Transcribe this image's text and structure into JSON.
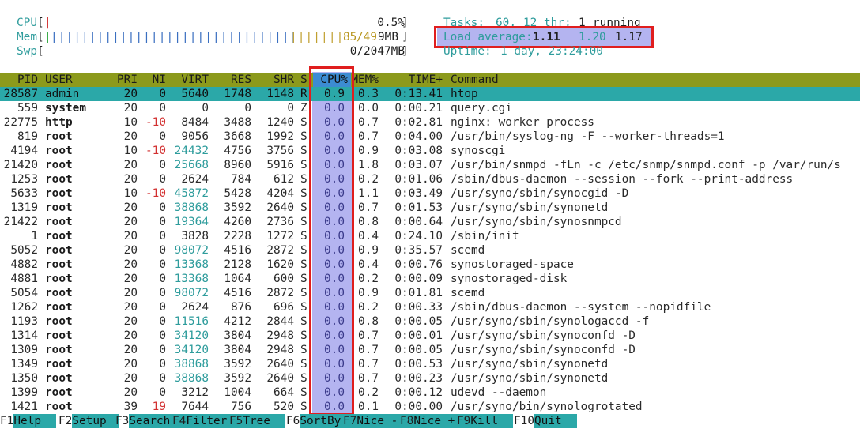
{
  "meters": {
    "cpu": {
      "label": "CPU",
      "bar": "|",
      "value": "0.5%"
    },
    "mem": {
      "label": "Mem",
      "bar_blue": "||||||||||||||||||||||||||||||||",
      "bar_yellow": "|||||||",
      "value_used": "85",
      "value_sep": "/49",
      "value_rest": "9MB"
    },
    "swp": {
      "label": "Swp",
      "value": "0/2047MB"
    }
  },
  "tasks": {
    "label": "Tasks:",
    "tasks": "60,",
    "thr_count": "12",
    "thr_label": "thr;",
    "running_count": "1",
    "running_label": "running"
  },
  "load": {
    "label": "Load average:",
    "l1": "1.11",
    "l5": "1.20",
    "l15": "1.17"
  },
  "uptime": {
    "label": "Uptime:",
    "value": "1 day, 23:24:00"
  },
  "columns": [
    "PID",
    "USER",
    "PRI",
    "NI",
    "VIRT",
    "RES",
    "SHR",
    "S",
    "CPU%",
    "MEM%",
    "TIME+",
    "Command"
  ],
  "processes": [
    {
      "pid": "28587",
      "user": "admin",
      "pri": "20",
      "ni": "0",
      "virt": "5640",
      "res": "1748",
      "shr": "1148",
      "s": "R",
      "cpu": "0.9",
      "mem": "0.3",
      "time": "0:13.41",
      "cmd": "htop"
    },
    {
      "pid": "559",
      "user": "system",
      "pri": "20",
      "ni": "0",
      "virt": "0",
      "res": "0",
      "shr": "0",
      "s": "Z",
      "cpu": "0.0",
      "mem": "0.0",
      "time": "0:00.21",
      "cmd": "query.cgi"
    },
    {
      "pid": "22775",
      "user": "http",
      "pri": "10",
      "ni": "-10",
      "virt": "8484",
      "res": "3488",
      "shr": "1240",
      "s": "S",
      "cpu": "0.0",
      "mem": "0.7",
      "time": "0:02.81",
      "cmd": "nginx: worker process"
    },
    {
      "pid": "819",
      "user": "root",
      "pri": "20",
      "ni": "0",
      "virt": "9056",
      "res": "3668",
      "shr": "1992",
      "s": "S",
      "cpu": "0.0",
      "mem": "0.7",
      "time": "0:04.00",
      "cmd": "/usr/bin/syslog-ng -F --worker-threads=1"
    },
    {
      "pid": "4194",
      "user": "root",
      "pri": "10",
      "ni": "-10",
      "virt": "24432",
      "res": "4756",
      "shr": "3756",
      "s": "S",
      "cpu": "0.0",
      "mem": "0.9",
      "time": "0:03.08",
      "cmd": "synoscgi"
    },
    {
      "pid": "21420",
      "user": "root",
      "pri": "20",
      "ni": "0",
      "virt": "25668",
      "res": "8960",
      "shr": "5916",
      "s": "S",
      "cpu": "0.0",
      "mem": "1.8",
      "time": "0:03.07",
      "cmd": "/usr/bin/snmpd -fLn -c /etc/snmp/snmpd.conf -p /var/run/s"
    },
    {
      "pid": "1253",
      "user": "root",
      "pri": "20",
      "ni": "0",
      "virt": "2624",
      "res": "784",
      "shr": "612",
      "s": "S",
      "cpu": "0.0",
      "mem": "0.2",
      "time": "0:01.06",
      "cmd": "/sbin/dbus-daemon --session --fork --print-address"
    },
    {
      "pid": "5633",
      "user": "root",
      "pri": "10",
      "ni": "-10",
      "virt": "45872",
      "res": "5428",
      "shr": "4204",
      "s": "S",
      "cpu": "0.0",
      "mem": "1.1",
      "time": "0:03.49",
      "cmd": "/usr/syno/sbin/synocgid -D"
    },
    {
      "pid": "1319",
      "user": "root",
      "pri": "20",
      "ni": "0",
      "virt": "38868",
      "res": "3592",
      "shr": "2640",
      "s": "S",
      "cpu": "0.0",
      "mem": "0.7",
      "time": "0:01.53",
      "cmd": "/usr/syno/sbin/synonetd"
    },
    {
      "pid": "21422",
      "user": "root",
      "pri": "20",
      "ni": "0",
      "virt": "19364",
      "res": "4260",
      "shr": "2736",
      "s": "S",
      "cpu": "0.0",
      "mem": "0.8",
      "time": "0:00.64",
      "cmd": "/usr/syno/sbin/synosnmpcd"
    },
    {
      "pid": "1",
      "user": "root",
      "pri": "20",
      "ni": "0",
      "virt": "3828",
      "res": "2228",
      "shr": "1272",
      "s": "S",
      "cpu": "0.0",
      "mem": "0.4",
      "time": "0:24.10",
      "cmd": "/sbin/init"
    },
    {
      "pid": "5052",
      "user": "root",
      "pri": "20",
      "ni": "0",
      "virt": "98072",
      "res": "4516",
      "shr": "2872",
      "s": "S",
      "cpu": "0.0",
      "mem": "0.9",
      "time": "0:35.57",
      "cmd": "scemd"
    },
    {
      "pid": "4882",
      "user": "root",
      "pri": "20",
      "ni": "0",
      "virt": "13368",
      "res": "2128",
      "shr": "1620",
      "s": "S",
      "cpu": "0.0",
      "mem": "0.4",
      "time": "0:00.76",
      "cmd": "synostoraged-space"
    },
    {
      "pid": "4881",
      "user": "root",
      "pri": "20",
      "ni": "0",
      "virt": "13368",
      "res": "1064",
      "shr": "600",
      "s": "S",
      "cpu": "0.0",
      "mem": "0.2",
      "time": "0:00.09",
      "cmd": "synostoraged-disk"
    },
    {
      "pid": "5054",
      "user": "root",
      "pri": "20",
      "ni": "0",
      "virt": "98072",
      "res": "4516",
      "shr": "2872",
      "s": "S",
      "cpu": "0.0",
      "mem": "0.9",
      "time": "0:01.81",
      "cmd": "scemd"
    },
    {
      "pid": "1262",
      "user": "root",
      "pri": "20",
      "ni": "0",
      "virt": "2624",
      "res": "876",
      "shr": "696",
      "s": "S",
      "cpu": "0.0",
      "mem": "0.2",
      "time": "0:00.33",
      "cmd": "/sbin/dbus-daemon --system --nopidfile"
    },
    {
      "pid": "1193",
      "user": "root",
      "pri": "20",
      "ni": "0",
      "virt": "11516",
      "res": "4212",
      "shr": "2844",
      "s": "S",
      "cpu": "0.0",
      "mem": "0.8",
      "time": "0:00.05",
      "cmd": "/usr/syno/sbin/synologaccd -f"
    },
    {
      "pid": "1314",
      "user": "root",
      "pri": "20",
      "ni": "0",
      "virt": "34120",
      "res": "3804",
      "shr": "2948",
      "s": "S",
      "cpu": "0.0",
      "mem": "0.7",
      "time": "0:00.01",
      "cmd": "/usr/syno/sbin/synoconfd -D"
    },
    {
      "pid": "1309",
      "user": "root",
      "pri": "20",
      "ni": "0",
      "virt": "34120",
      "res": "3804",
      "shr": "2948",
      "s": "S",
      "cpu": "0.0",
      "mem": "0.7",
      "time": "0:00.05",
      "cmd": "/usr/syno/sbin/synoconfd -D"
    },
    {
      "pid": "1349",
      "user": "root",
      "pri": "20",
      "ni": "0",
      "virt": "38868",
      "res": "3592",
      "shr": "2640",
      "s": "S",
      "cpu": "0.0",
      "mem": "0.7",
      "time": "0:00.53",
      "cmd": "/usr/syno/sbin/synonetd"
    },
    {
      "pid": "1350",
      "user": "root",
      "pri": "20",
      "ni": "0",
      "virt": "38868",
      "res": "3592",
      "shr": "2640",
      "s": "S",
      "cpu": "0.0",
      "mem": "0.7",
      "time": "0:00.23",
      "cmd": "/usr/syno/sbin/synonetd"
    },
    {
      "pid": "1399",
      "user": "root",
      "pri": "20",
      "ni": "0",
      "virt": "3212",
      "res": "1004",
      "shr": "664",
      "s": "S",
      "cpu": "0.0",
      "mem": "0.2",
      "time": "0:00.12",
      "cmd": "udevd --daemon"
    },
    {
      "pid": "1421",
      "user": "root",
      "pri": "39",
      "ni": "19",
      "virt": "7644",
      "res": "756",
      "shr": "520",
      "s": "S",
      "cpu": "0.0",
      "mem": "0.1",
      "time": "0:00.00",
      "cmd": "/usr/syno/bin/synologrotated"
    }
  ],
  "fkeys": [
    {
      "key": "F1",
      "label": "Help"
    },
    {
      "key": "F2",
      "label": "Setup"
    },
    {
      "key": "F3",
      "label": "Search"
    },
    {
      "key": "F4",
      "label": "Filter"
    },
    {
      "key": "F5",
      "label": "Tree"
    },
    {
      "key": "F6",
      "label": "SortBy"
    },
    {
      "key": "F7",
      "label": "Nice -"
    },
    {
      "key": "F8",
      "label": "Nice +"
    },
    {
      "key": "F9",
      "label": "Kill"
    },
    {
      "key": "F10",
      "label": "Quit"
    }
  ],
  "colors": {
    "header_bg": "#8c9a1c",
    "selected_bg": "#2ba8a8",
    "sort_col": "#3c8cd2",
    "highlight": "#b4b4f0",
    "annotation": "#e01e1e"
  }
}
